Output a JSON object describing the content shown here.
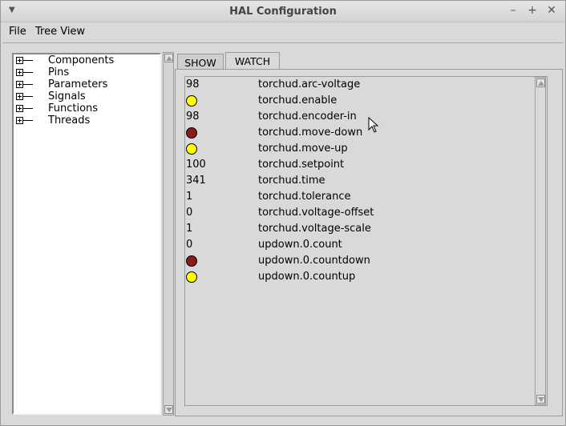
{
  "window": {
    "title": "HAL Configuration",
    "controls": {
      "minimize": "–",
      "maximize": "+",
      "close": "✕"
    }
  },
  "menubar": {
    "items": [
      "File",
      "Tree View"
    ]
  },
  "tree": {
    "items": [
      "Components",
      "Pins",
      "Parameters",
      "Signals",
      "Functions",
      "Threads"
    ]
  },
  "tabs": [
    {
      "label": "SHOW",
      "active": false
    },
    {
      "label": "WATCH",
      "active": true
    }
  ],
  "watch": {
    "colors": {
      "led_on": "#ffff00",
      "led_off": "#8b1a1a"
    },
    "rows": [
      {
        "type": "value",
        "value": "98",
        "name": "torchud.arc-voltage"
      },
      {
        "type": "led",
        "state": "on",
        "name": "torchud.enable"
      },
      {
        "type": "value",
        "value": "98",
        "name": "torchud.encoder-in"
      },
      {
        "type": "led",
        "state": "off",
        "name": "torchud.move-down"
      },
      {
        "type": "led",
        "state": "on",
        "name": "torchud.move-up"
      },
      {
        "type": "value",
        "value": "100",
        "name": "torchud.setpoint"
      },
      {
        "type": "value",
        "value": "341",
        "name": "torchud.time"
      },
      {
        "type": "value",
        "value": "1",
        "name": "torchud.tolerance"
      },
      {
        "type": "value",
        "value": "0",
        "name": "torchud.voltage-offset"
      },
      {
        "type": "value",
        "value": "1",
        "name": "torchud.voltage-scale"
      },
      {
        "type": "value",
        "value": "0",
        "name": "updown.0.count"
      },
      {
        "type": "led",
        "state": "off",
        "name": "updown.0.countdown"
      },
      {
        "type": "led",
        "state": "on",
        "name": "updown.0.countup"
      }
    ]
  }
}
